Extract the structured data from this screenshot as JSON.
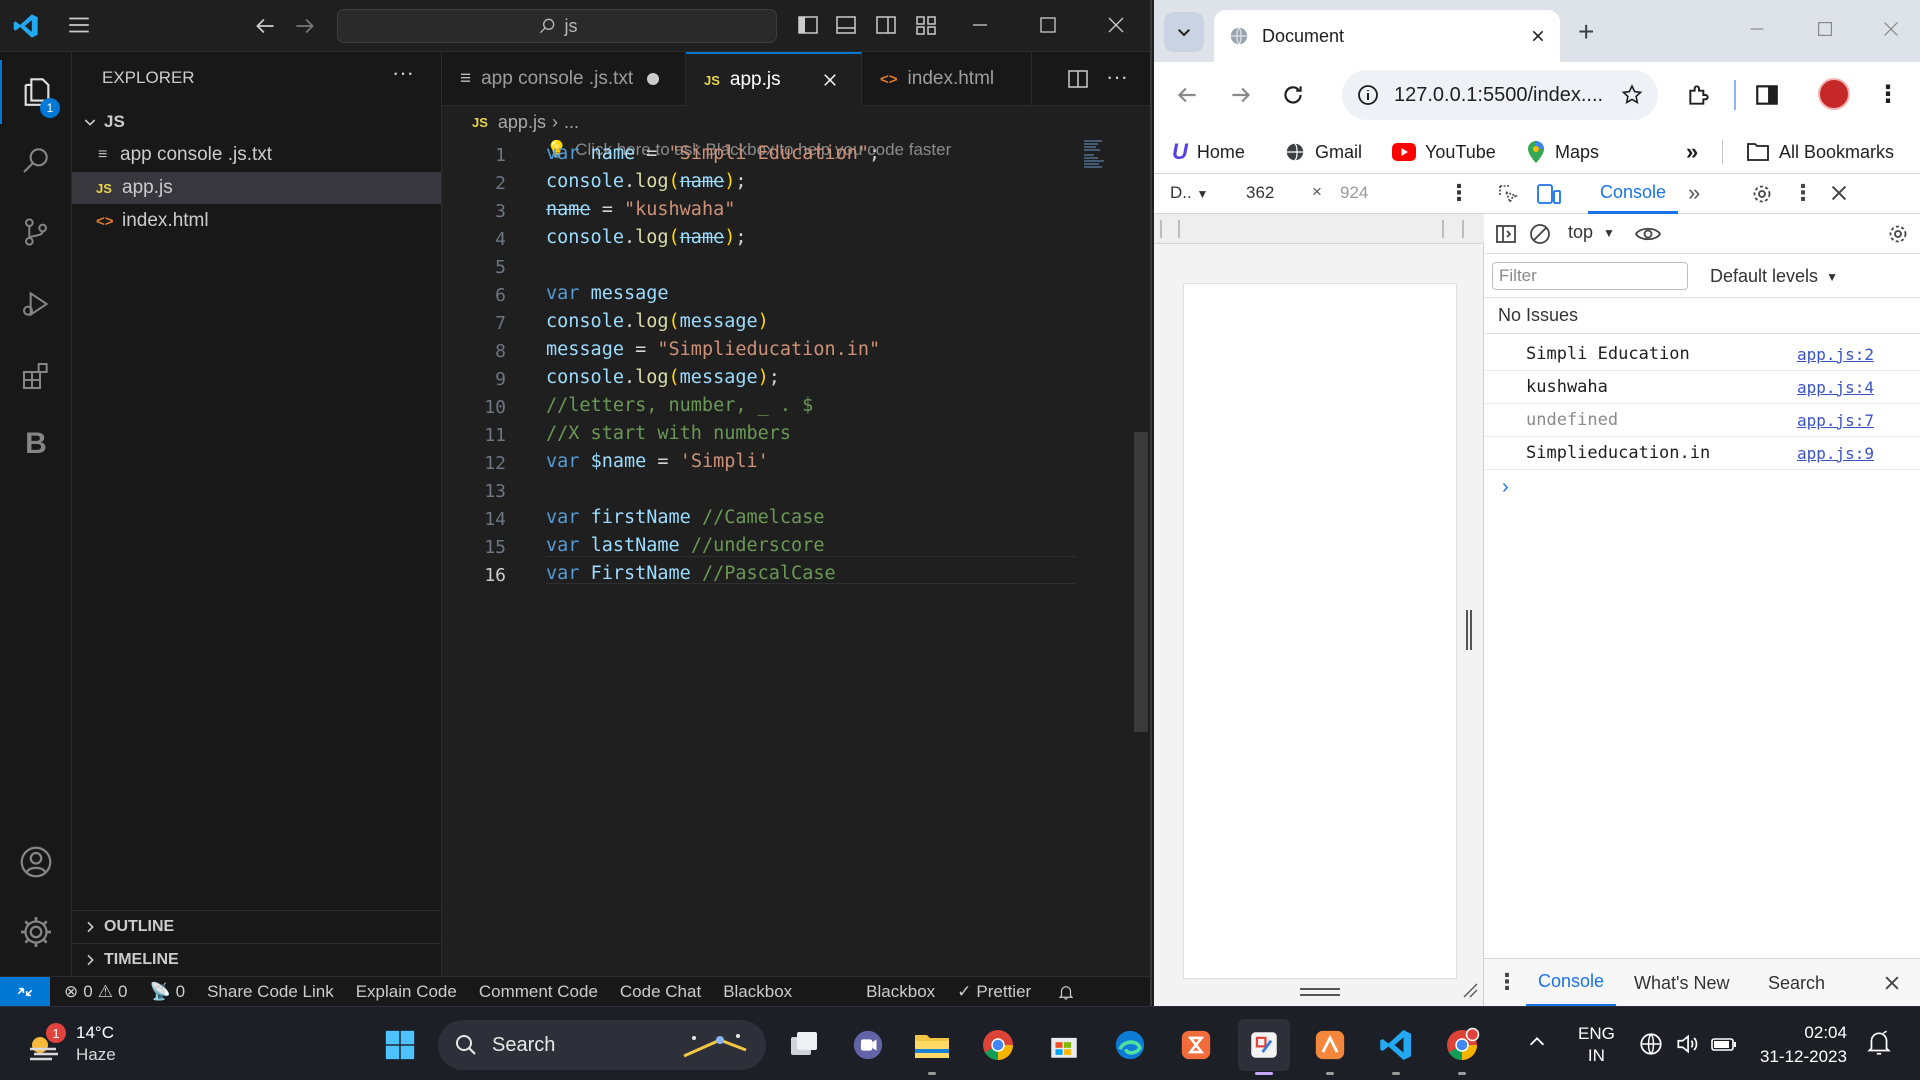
{
  "vscode": {
    "search_text": "js",
    "explorer_title": "EXPLORER",
    "explorer_badge": "1",
    "folder": "JS",
    "files": [
      {
        "name": "app console .js.txt",
        "icon": "text-file-icon"
      },
      {
        "name": "app.js",
        "icon": "js-file-icon"
      },
      {
        "name": "index.html",
        "icon": "html-file-icon"
      }
    ],
    "outline_label": "OUTLINE",
    "timeline_label": "TIMELINE",
    "tabs": [
      {
        "label": "app console .js.txt",
        "icon": "≡"
      },
      {
        "label": "app.js",
        "icon": "JS"
      },
      {
        "label": "index.html",
        "icon": "<>"
      }
    ],
    "breadcrumb_file": "app.js",
    "breadcrumb_rest": "...",
    "blackbox_hint": "Click here to ask Blackbox to help you code faster",
    "line_numbers": [
      "1",
      "2",
      "3",
      "4",
      "5",
      "6",
      "7",
      "8",
      "9",
      "10",
      "11",
      "12",
      "13",
      "14",
      "15",
      "16"
    ],
    "code_lines": [
      "var name = \"Simpli Education\";",
      "console.log(name);",
      "name = \"kushwaha\"",
      "console.log(name);",
      "",
      "var message",
      "console.log(message)",
      "message = \"Simplieducation.in\"",
      "console.log(message);",
      "//letters, number, _ . $",
      "//X start with numbers",
      "var $name = 'Simpli'",
      "",
      "var firstName //Camelcase",
      "var lastName //underscore",
      "var FirstName //PascalCase"
    ],
    "status": {
      "errors": "0",
      "warnings": "0",
      "ports": "0",
      "share": "Share Code Link",
      "explain": "Explain Code",
      "comment": "Comment Code",
      "chat": "Code Chat",
      "blackbox1": "Blackbox",
      "blackbox2": "Blackbox",
      "prettier": "Prettier"
    }
  },
  "chrome": {
    "tab_title": "Document",
    "url": "127.0.0.1:5500/index....",
    "bookmarks": [
      "Home",
      "Gmail",
      "YouTube",
      "Maps"
    ],
    "all_bookmarks": "All Bookmarks",
    "devtools": {
      "device": "D..",
      "width": "362",
      "height": "924",
      "panel": "Console",
      "context": "top",
      "filter_placeholder": "Filter",
      "levels": "Default levels",
      "issues": "No Issues",
      "logs": [
        {
          "msg": "Simpli Education",
          "src": "app.js:2"
        },
        {
          "msg": "kushwaha",
          "src": "app.js:4"
        },
        {
          "msg": "undefined",
          "src": "app.js:7"
        },
        {
          "msg": "Simplieducation.in",
          "src": "app.js:9"
        }
      ],
      "drawer_tabs": [
        "Console",
        "What's New",
        "Search"
      ]
    }
  },
  "taskbar": {
    "weather_temp": "14°C",
    "weather_desc": "Haze",
    "weather_badge": "1",
    "search_label": "Search",
    "lang1": "ENG",
    "lang2": "IN",
    "time": "02:04",
    "date": "31-12-2023"
  }
}
